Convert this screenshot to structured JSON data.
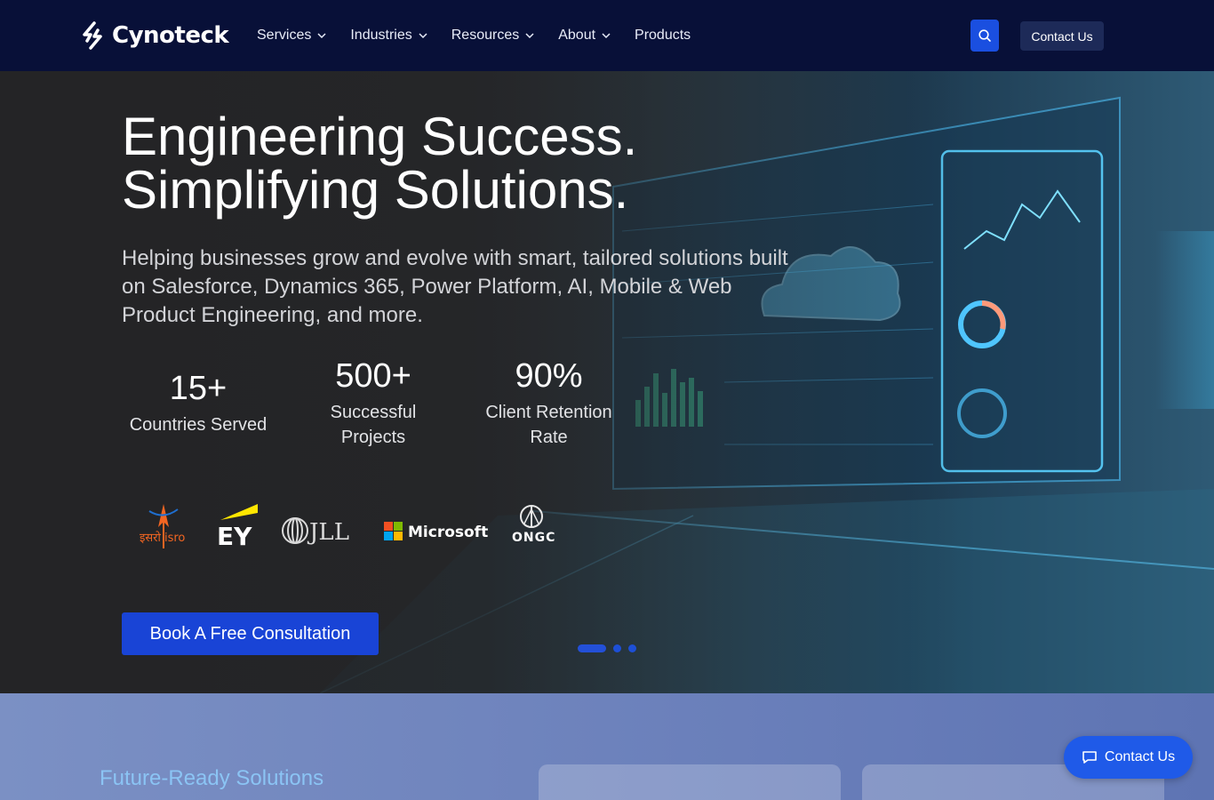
{
  "brand": {
    "name": "Cynoteck"
  },
  "nav": {
    "items": [
      {
        "label": "Services",
        "has_dropdown": true
      },
      {
        "label": "Industries",
        "has_dropdown": true
      },
      {
        "label": "Resources",
        "has_dropdown": true
      },
      {
        "label": "About",
        "has_dropdown": true
      },
      {
        "label": "Products",
        "has_dropdown": false
      }
    ],
    "search_icon": "search-icon",
    "contact_label": "Contact Us"
  },
  "hero": {
    "title_line1": "Engineering Success.",
    "title_line2": "Simplifying Solutions.",
    "subtitle": "Helping businesses grow and evolve with smart, tailored solutions built on Salesforce, Dynamics 365, Power Platform, AI, Mobile & Web Product Engineering, and more.",
    "stats": [
      {
        "value": "15+",
        "label": "Countries Served"
      },
      {
        "value": "500+",
        "label": "Successful Projects"
      },
      {
        "value": "90%",
        "label": "Client Retention Rate"
      }
    ],
    "client_logos": [
      "ISRO",
      "EY",
      "JLL",
      "Microsoft",
      "ONGC"
    ],
    "client_logo_text": {
      "isro": "इसरो isro",
      "ey": "EY",
      "jll": "JLL",
      "microsoft": "Microsoft",
      "ongc": "ONGC"
    },
    "cta_label": "Book A Free Consultation",
    "carousel": {
      "slides": 3,
      "active": 1
    }
  },
  "section": {
    "title": "Future-Ready Solutions"
  },
  "chat": {
    "label": "Contact Us",
    "icon": "chat-bubble-icon"
  },
  "colors": {
    "nav_bg": "#081038",
    "accent": "#1944d6",
    "section_bg": "#7088c0",
    "section_title": "#8bc4f4"
  }
}
